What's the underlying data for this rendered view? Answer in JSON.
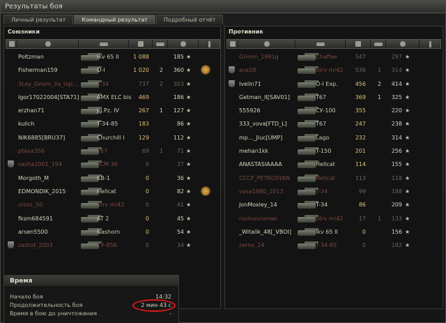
{
  "window": {
    "title": "Результаты боя"
  },
  "tabs": [
    {
      "label": "Личный результат",
      "active": false
    },
    {
      "label": "Командный результат",
      "active": true
    },
    {
      "label": "Подробный отчёт",
      "active": false
    }
  ],
  "allies": {
    "title": "Союзники",
    "columns": [
      "clan-icon",
      "player-icon",
      "vehicle-icon",
      "damage-icon",
      "frags-icon",
      "xp-icon",
      "medal-icon"
    ],
    "rows": [
      {
        "name": "Poltzman",
        "vehicle": "Ikv 65 II",
        "damage": "1 088",
        "kills": "",
        "xp": "185",
        "dead": false,
        "self": true,
        "clan": false,
        "medal": false
      },
      {
        "name": "Fisherman159",
        "vehicle": "O-I",
        "damage": "1 020",
        "kills": "2",
        "xp": "360",
        "dead": false,
        "self": false,
        "clan": false,
        "medal": true
      },
      {
        "name": "3Loy_Gnom_3a_Ugl...",
        "vehicle": "T-34",
        "damage": "737",
        "kills": "2",
        "xp": "303",
        "dead": true,
        "self": false,
        "clan": false,
        "medal": false
      },
      {
        "name": "Igor17022004[STA71]",
        "vehicle": "AMX ELC bis",
        "damage": "469",
        "kills": "",
        "xp": "186",
        "dead": false,
        "self": false,
        "clan": false,
        "medal": false
      },
      {
        "name": "erzhan71",
        "vehicle": "Jg.Pz. IV",
        "damage": "267",
        "kills": "1",
        "xp": "127",
        "dead": false,
        "self": false,
        "clan": false,
        "medal": false
      },
      {
        "name": "kulich",
        "vehicle": "T-34-85",
        "damage": "183",
        "kills": "",
        "xp": "86",
        "dead": false,
        "self": false,
        "clan": false,
        "medal": false
      },
      {
        "name": "NIK6885[BRU37]",
        "vehicle": "Churchill I",
        "damage": "129",
        "kills": "",
        "xp": "112",
        "dead": false,
        "self": false,
        "clan": false,
        "medal": false
      },
      {
        "name": "ptaxa356",
        "vehicle": "T67",
        "damage": "69",
        "kills": "1",
        "xp": "71",
        "dead": true,
        "self": false,
        "clan": false,
        "medal": false
      },
      {
        "name": "sasha2001_194",
        "vehicle": "FCM 36",
        "damage": "0",
        "kills": "",
        "xp": "37",
        "dead": true,
        "self": false,
        "clan": true,
        "medal": false
      },
      {
        "name": "Morgoth_M",
        "vehicle": "KB-1",
        "damage": "0",
        "kills": "",
        "xp": "36",
        "dead": false,
        "self": false,
        "clan": false,
        "medal": false
      },
      {
        "name": "EDMONDIK_2015",
        "vehicle": "Hellcat",
        "damage": "0",
        "kills": "",
        "xp": "82",
        "dead": false,
        "self": false,
        "clan": false,
        "medal": true
      },
      {
        "name": "cross_50",
        "vehicle": "Strv m/42",
        "damage": "0",
        "kills": "",
        "xp": "41",
        "dead": true,
        "self": false,
        "clan": false,
        "medal": false
      },
      {
        "name": "fksm684591",
        "vehicle": "AT 2",
        "damage": "0",
        "kills": "",
        "xp": "45",
        "dead": false,
        "self": false,
        "clan": false,
        "medal": false
      },
      {
        "name": "arsen5500",
        "vehicle": "Nashorn",
        "damage": "0",
        "kills": "",
        "xp": "54",
        "dead": false,
        "self": false,
        "clan": false,
        "medal": false
      },
      {
        "name": "zadrot_2003",
        "vehicle": "СУ-85Б",
        "damage": "0",
        "kills": "",
        "xp": "34",
        "dead": true,
        "self": false,
        "clan": true,
        "medal": false
      }
    ]
  },
  "enemies": {
    "title": "Противник",
    "rows": [
      {
        "name": "Grimm_1991g",
        "vehicle": "Chaffee",
        "damage": "547",
        "kills": "",
        "xp": "297",
        "dead": true,
        "clan": false
      },
      {
        "name": "ace28",
        "vehicle": "Strv m/42",
        "damage": "536",
        "kills": "1",
        "xp": "314",
        "dead": true,
        "clan": true
      },
      {
        "name": "Ivelin71",
        "vehicle": "O-I Exp.",
        "damage": "456",
        "kills": "2",
        "xp": "414",
        "dead": false,
        "clan": true
      },
      {
        "name": "Getman_II[SAV01]",
        "vehicle": "T67",
        "damage": "369",
        "kills": "1",
        "xp": "325",
        "dead": false,
        "clan": false
      },
      {
        "name": "555926",
        "vehicle": "СУ-100",
        "damage": "355",
        "kills": "",
        "xp": "220",
        "dead": false,
        "clan": false
      },
      {
        "name": "333_vova[FTD_L]",
        "vehicle": "T67",
        "damage": "247",
        "kills": "",
        "xp": "238",
        "dead": false,
        "clan": false
      },
      {
        "name": "mp..._Jluc[UMP]",
        "vehicle": "Lago",
        "damage": "232",
        "kills": "",
        "xp": "314",
        "dead": false,
        "clan": false
      },
      {
        "name": "mehan1kk",
        "vehicle": "T-150",
        "damage": "201",
        "kills": "",
        "xp": "256",
        "dead": false,
        "clan": false
      },
      {
        "name": "ANASTASIAAAA",
        "vehicle": "Hellcat",
        "damage": "114",
        "kills": "",
        "xp": "155",
        "dead": false,
        "clan": false
      },
      {
        "name": "CCCP_PETROSYAN",
        "vehicle": "Hellcat",
        "damage": "113",
        "kills": "",
        "xp": "118",
        "dead": true,
        "clan": false
      },
      {
        "name": "vasa1980_2013",
        "vehicle": "T-34",
        "damage": "99",
        "kills": "",
        "xp": "188",
        "dead": true,
        "clan": false
      },
      {
        "name": "JonMoxley_14",
        "vehicle": "T-34",
        "damage": "86",
        "kills": "",
        "xp": "209",
        "dead": false,
        "clan": false
      },
      {
        "name": "rusinovroman",
        "vehicle": "Strv m/42",
        "damage": "17",
        "kills": "1",
        "xp": "133",
        "dead": true,
        "clan": false
      },
      {
        "name": "_Witalik_48[_VBOI]",
        "vehicle": "Ikv 65 II",
        "damage": "0",
        "kills": "",
        "xp": "156",
        "dead": false,
        "clan": false
      },
      {
        "name": "zerno_24",
        "vehicle": "T-34-85",
        "damage": "0",
        "kills": "",
        "xp": "182",
        "dead": true,
        "clan": false
      }
    ]
  },
  "time": {
    "title": "Время",
    "start_label": "Начало боя",
    "start_value": "14:32",
    "duration_label": "Продолжительность боя",
    "duration_value": "2 мин 43 с",
    "alive_label": "Время в бою до уничтожения",
    "alive_value": "-"
  },
  "colors": {
    "highlight": "#d81818",
    "damage": "#e2c27a",
    "dead": "#7e4a45"
  }
}
